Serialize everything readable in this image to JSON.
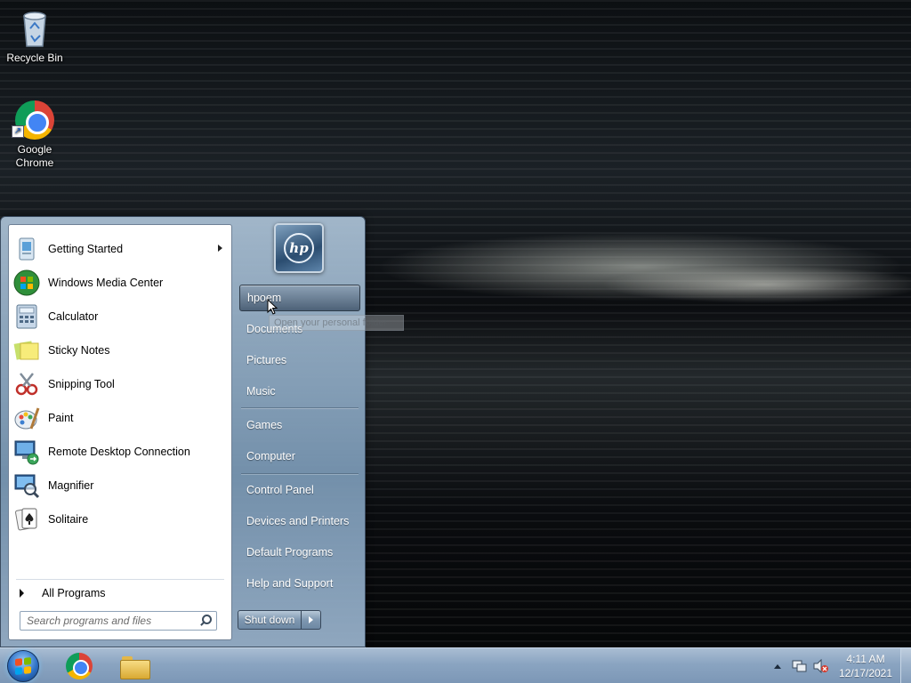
{
  "desktop": {
    "icons": [
      {
        "label": "Recycle Bin",
        "icon": "recycle-bin-icon"
      },
      {
        "label": "Google\nChrome",
        "line1": "Google",
        "line2": "Chrome",
        "icon": "chrome-icon"
      }
    ]
  },
  "start_menu": {
    "programs": [
      {
        "label": "Getting Started",
        "icon": "getting-started-icon",
        "has_submenu": true
      },
      {
        "label": "Windows Media Center",
        "icon": "media-center-icon"
      },
      {
        "label": "Calculator",
        "icon": "calculator-icon"
      },
      {
        "label": "Sticky Notes",
        "icon": "sticky-notes-icon"
      },
      {
        "label": "Snipping Tool",
        "icon": "snipping-tool-icon"
      },
      {
        "label": "Paint",
        "icon": "paint-icon"
      },
      {
        "label": "Remote Desktop Connection",
        "icon": "remote-desktop-icon"
      },
      {
        "label": "Magnifier",
        "icon": "magnifier-icon"
      },
      {
        "label": "Solitaire",
        "icon": "solitaire-icon"
      }
    ],
    "all_programs": "All Programs",
    "search_placeholder": "Search programs and files",
    "user_picture_text": "hp",
    "right_items": [
      {
        "label": "hpoem",
        "hovered": true
      },
      {
        "label": "Documents"
      },
      {
        "label": "Pictures"
      },
      {
        "label": "Music"
      },
      {
        "label": "Games"
      },
      {
        "label": "Computer"
      },
      {
        "label": "Control Panel"
      },
      {
        "label": "Devices and Printers"
      },
      {
        "label": "Default Programs"
      },
      {
        "label": "Help and Support"
      }
    ],
    "tooltip": "Open your personal folder",
    "shutdown_label": "Shut down"
  },
  "taskbar": {
    "pinned": [
      {
        "name": "Google Chrome",
        "icon": "chrome-icon"
      },
      {
        "name": "Windows Explorer",
        "icon": "folder-icon"
      }
    ],
    "clock": {
      "time": "4:11 AM",
      "date": "12/17/2021"
    }
  },
  "colors": {
    "taskbar": "#8aa4c1",
    "start_menu_right_pane": "#7896b2",
    "hover_item": "#4a607a"
  }
}
